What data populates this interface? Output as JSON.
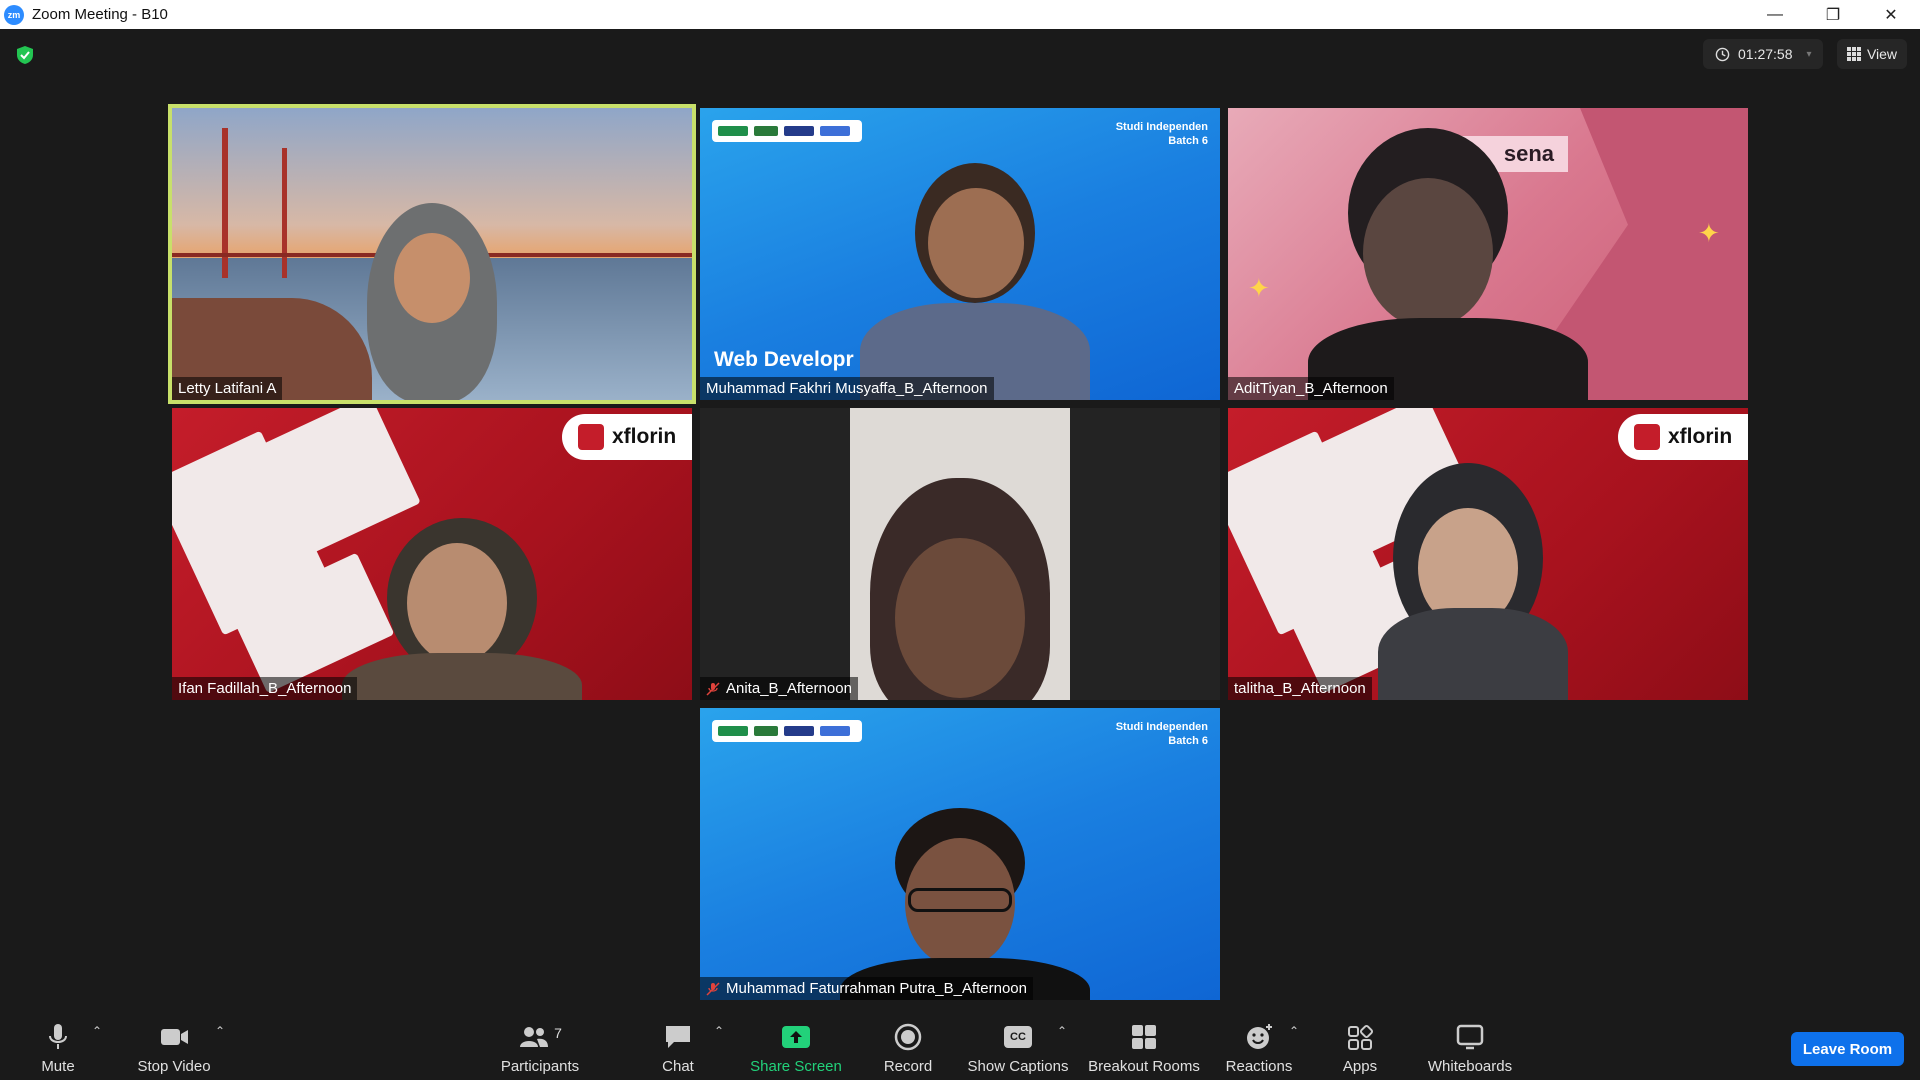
{
  "window": {
    "title": "Zoom Meeting - B10",
    "logo_text": "zm",
    "minimize": "—",
    "restore": "❐",
    "close": "✕"
  },
  "header": {
    "timer": "01:27:58",
    "view_label": "View"
  },
  "tiles": [
    {
      "name": "Letty Latifani A",
      "muted": false,
      "active": true
    },
    {
      "name": "Muhammad Fakhri Musyaffa_B_Afternoon",
      "muted": false,
      "overlay_top": "Studi Independen",
      "overlay_sub": "Batch 6",
      "overlay_big": "Web Developr"
    },
    {
      "name": "AditTiyan_B_Afternoon",
      "muted": false,
      "overlay_label": "sena"
    },
    {
      "name": "Ifan Fadillah_B_Afternoon",
      "muted": false,
      "brand": "xflorin"
    },
    {
      "name": "Anita_B_Afternoon",
      "muted": true
    },
    {
      "name": "talitha_B_Afternoon",
      "muted": false,
      "brand": "xflorin"
    },
    {
      "name": "Muhammad Faturrahman Putra_B_Afternoon",
      "muted": true,
      "overlay_top": "Studi Independen",
      "overlay_sub": "Batch 6"
    }
  ],
  "toolbar": {
    "mute": "Mute",
    "stop_video": "Stop Video",
    "participants": "Participants",
    "participants_count": "7",
    "chat": "Chat",
    "share_screen": "Share Screen",
    "record": "Record",
    "show_captions": "Show Captions",
    "cc_text": "CC",
    "breakout_rooms": "Breakout Rooms",
    "reactions": "Reactions",
    "apps": "Apps",
    "whiteboards": "Whiteboards",
    "leave_room": "Leave Room"
  },
  "colors": {
    "active_speaker_border": "#c8e06a",
    "share_green": "#22d17a",
    "leave_blue": "#0e71eb",
    "background": "#1a1a1a"
  }
}
